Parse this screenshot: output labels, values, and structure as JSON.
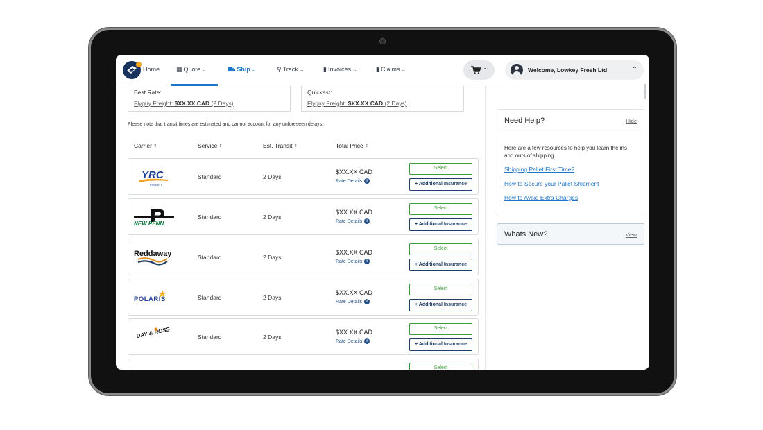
{
  "nav": {
    "logo_icon": "brand-logo-icon",
    "items": [
      {
        "label": "Home",
        "icon": "logo"
      },
      {
        "label": "Quote",
        "icon": "calculator-icon"
      },
      {
        "label": "Ship",
        "icon": "truck-icon",
        "active": true
      },
      {
        "label": "Track",
        "icon": "search-icon"
      },
      {
        "label": "Invoices",
        "icon": "document-icon"
      },
      {
        "label": "Claims",
        "icon": "document-icon"
      }
    ],
    "cart_icon": "cart-icon",
    "welcome": "Welcome, Lowkey Fresh Ltd"
  },
  "summary": {
    "best_rate_label": "Best Rate:",
    "best_rate_carrier": "Flyguy Freight:",
    "best_rate_price": "$XX.XX CAD",
    "best_rate_days": "(2 Days)",
    "quickest_label": "Quickest:",
    "quickest_carrier": "Flyguy Freight:",
    "quickest_price": "$XX.XX CAD",
    "quickest_days": "(2 Days)"
  },
  "note": "Please note that transit times are estimated and cannot account for any unforeseen delays.",
  "table": {
    "headers": [
      "Carrier",
      "Service",
      "Est. Transit",
      "Total Price"
    ],
    "select_label": "Select",
    "insurance_label": "+ Additional Insurance",
    "rate_details_label": "Rate Details",
    "rows": [
      {
        "carrier": "YRC",
        "carrier_sub": "FREIGHT",
        "service": "Standard",
        "transit": "2 Days",
        "price": "$XX.XX CAD"
      },
      {
        "carrier": "NEW PENN",
        "service": "Standard",
        "transit": "2 Days",
        "price": "$XX.XX CAD"
      },
      {
        "carrier": "Reddaway",
        "service": "Standard",
        "transit": "2 Days",
        "price": "$XX.XX CAD"
      },
      {
        "carrier": "POLARIS",
        "service": "Standard",
        "transit": "2 Days",
        "price": "$XX.XX CAD"
      },
      {
        "carrier": "DAY & ROSS",
        "service": "Standard",
        "transit": "2 Days",
        "price": "$XX.XX CAD"
      }
    ],
    "partial_row_select": "Select"
  },
  "help": {
    "title": "Need Help?",
    "hide_label": "Hide",
    "description": "Here are a few resources to help you learn the ins and outs of shipping.",
    "links": [
      "Shipping Pallet First Time?",
      "How to Secure your Pallet Shipment",
      "How to Avoid Extra Charges"
    ]
  },
  "whats_new": {
    "title": "Whats New?",
    "view_label": "View"
  },
  "colors": {
    "accent": "#1d74c9",
    "select_green": "#3c9b3c",
    "insurance_navy": "#1f3d66"
  }
}
